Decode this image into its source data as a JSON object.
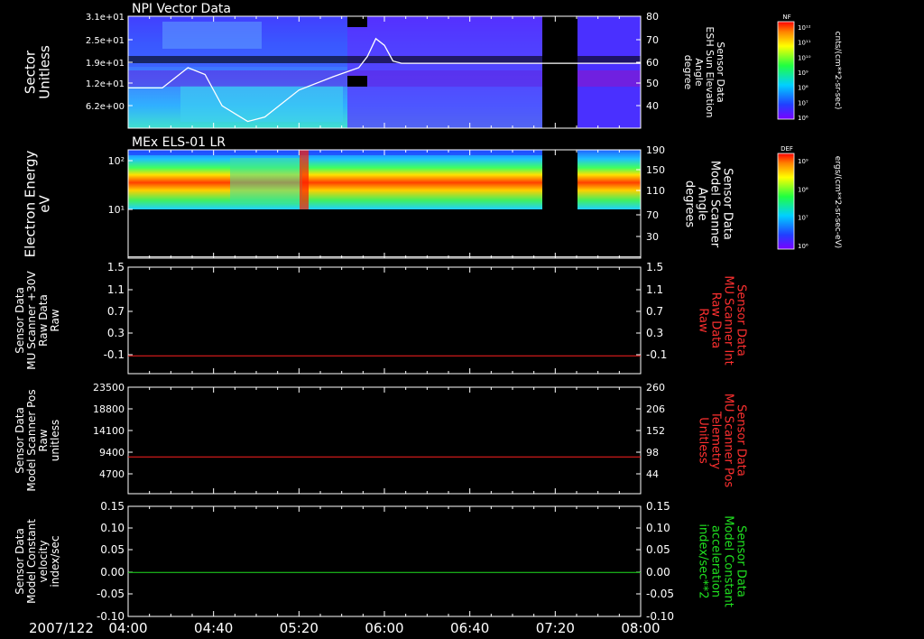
{
  "date_label": "2007/122",
  "time_ticks": [
    "04:00",
    "04:40",
    "05:20",
    "06:00",
    "06:40",
    "07:20",
    "08:00"
  ],
  "panel1": {
    "title": "NPI Vector Data",
    "left_label": [
      "Sector",
      "Unitless"
    ],
    "left_ticks": [
      "3.1e+01",
      "2.5e+01",
      "1.9e+01",
      "1.2e+01",
      "6.2e+00"
    ],
    "right_label": [
      "Sensor Data",
      "ESH Sun Elevation",
      "Angle",
      "degree"
    ],
    "right_ticks": [
      "80",
      "70",
      "60",
      "50",
      "40"
    ],
    "colorbar_title": "NF",
    "colorbar_ticks": [
      "10¹²",
      "10¹¹",
      "10¹⁰",
      "10⁹",
      "10⁸",
      "10⁷",
      "10⁶"
    ],
    "colorbar_units": "cnts/(cm**2-sr-sec)"
  },
  "panel2": {
    "title": "MEx ELS-01 LR",
    "left_label": [
      "Electron Energy",
      "eV"
    ],
    "left_ticks": [
      "10²",
      "10¹"
    ],
    "right_label": [
      "Sensor Data",
      "Model Scanner",
      "Angle",
      "degrees"
    ],
    "right_ticks": [
      "190",
      "150",
      "110",
      "70",
      "30"
    ],
    "colorbar_title": "DEF",
    "colorbar_ticks": [
      "10⁹",
      "10⁸",
      "10⁷",
      "10⁶"
    ],
    "colorbar_units": "ergs/(cm**2-sr-sec-eV)"
  },
  "panel3": {
    "left_label": [
      "Sensor Data",
      "MU Scanner +30V",
      "Raw Data",
      "Raw"
    ],
    "left_ticks": [
      "1.5",
      "1.1",
      "0.7",
      "0.3",
      "-0.1"
    ],
    "right_label": [
      "Sensor Data",
      "MU Scanner Int",
      "Raw Data",
      "Raw"
    ],
    "right_ticks": [
      "1.5",
      "1.1",
      "0.7",
      "0.3",
      "-0.1"
    ],
    "line_color": "#ff2020"
  },
  "panel4": {
    "left_label": [
      "Sensor Data",
      "Model Scanner Pos",
      "Raw",
      "unitless"
    ],
    "left_ticks": [
      "23500",
      "18800",
      "14100",
      "9400",
      "4700"
    ],
    "right_label": [
      "Sensor Data",
      "MU Scanner Pos",
      "Telemetry",
      "Unitless"
    ],
    "right_ticks": [
      "260",
      "206",
      "152",
      "98",
      "44"
    ],
    "line_color": "#ff2020"
  },
  "panel5": {
    "left_label": [
      "Sensor Data",
      "Model Constant",
      "velocity",
      "index/sec"
    ],
    "left_ticks": [
      "0.15",
      "0.10",
      "0.05",
      "0.00",
      "-0.05",
      "-0.10"
    ],
    "right_label": [
      "Sensor Data",
      "Model Constant",
      "acceleration",
      "index/sec**2"
    ],
    "right_ticks": [
      "0.15",
      "0.10",
      "0.05",
      "0.00",
      "-0.05",
      "-0.10"
    ],
    "line_color": "#20e020"
  },
  "chart_data": [
    {
      "type": "heatmap",
      "title": "NPI Vector Data",
      "ylabel": "Sector Unitless",
      "y_ticks": [
        31,
        25,
        19,
        12,
        6.2
      ],
      "x_range": [
        "04:00",
        "08:00"
      ],
      "data_gap": [
        "07:04",
        "07:24"
      ],
      "overlay_line": {
        "name": "ESH Sun Elevation Angle",
        "unit": "degree",
        "ylim": [
          30,
          80
        ],
        "x": [
          "04:00",
          "04:16",
          "04:28",
          "04:36",
          "04:44",
          "04:56",
          "05:04",
          "05:20",
          "05:36",
          "05:48",
          "05:52",
          "05:56",
          "06:00",
          "06:04",
          "06:08",
          "06:20",
          "07:00",
          "07:24",
          "08:00"
        ],
        "y": [
          48,
          48,
          57,
          54,
          40,
          33,
          35,
          47,
          53,
          57,
          62,
          70,
          67,
          60,
          59,
          59,
          59,
          59,
          59
        ]
      }
    },
    {
      "type": "heatmap",
      "title": "MEx ELS-01 LR",
      "ylabel": "Electron Energy eV",
      "x_range": [
        "04:00",
        "08:00"
      ],
      "data_gap": [
        "07:04",
        "07:24"
      ],
      "overlay_line": {
        "name": "Model Scanner Angle",
        "unit": "degrees",
        "ylim": [
          10,
          190
        ],
        "value": 12
      }
    },
    {
      "type": "line",
      "series": [
        {
          "name": "MU Scanner +30V Raw Data",
          "values": [
            0.0,
            0.0
          ]
        }
      ],
      "x": [
        "04:00",
        "08:00"
      ],
      "ylim": [
        -0.3,
        1.5
      ]
    },
    {
      "type": "line",
      "series": [
        {
          "name": "Model Scanner Pos Raw",
          "values": [
            8100,
            8100
          ]
        }
      ],
      "x": [
        "04:00",
        "08:00"
      ],
      "ylim": [
        0,
        23500
      ]
    },
    {
      "type": "line",
      "series": [
        {
          "name": "Model Constant velocity",
          "values": [
            0.0,
            0.0
          ]
        }
      ],
      "x": [
        "04:00",
        "08:00"
      ],
      "ylim": [
        -0.1,
        0.15
      ]
    }
  ]
}
